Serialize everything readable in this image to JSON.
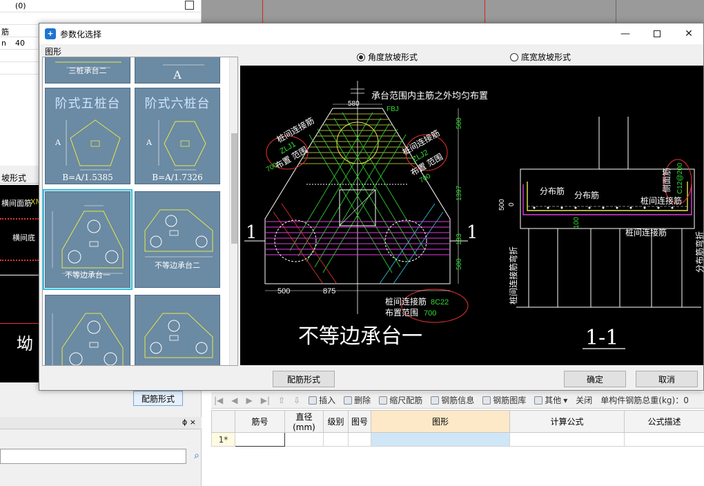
{
  "background": {
    "left_top_rows": [
      "(0)",
      "",
      "筋",
      "n",
      "40"
    ],
    "left_mid_label": "坡形式",
    "cad_left_texts": [
      "横间面筋",
      "XM",
      "横间底",
      "坳"
    ],
    "behind_button": "配筋形式",
    "panel_pin": "ɸ ×"
  },
  "toolbar": {
    "items": [
      "插入",
      "删除",
      "缩尺配筋",
      "钢筋信息",
      "钢筋图库",
      "其他",
      "关闭"
    ],
    "total_label": "单构件钢筋总重(kg)：0"
  },
  "grid": {
    "headers": [
      "",
      "筋号",
      "直径(mm)",
      "级别",
      "图号",
      "图形",
      "计算公式",
      "公式描述"
    ],
    "rows": [
      [
        "1*",
        "",
        "",
        "",
        "",
        "",
        "",
        ""
      ]
    ]
  },
  "dialog": {
    "title": "参数化选择",
    "shape_label": "图形",
    "radio_angle": "角度放坡形式",
    "radio_width": "底宽放坡形式",
    "btn_config": "配筋形式",
    "btn_ok": "确定",
    "btn_cancel": "取消"
  },
  "thumbnails": [
    {
      "label": "三桩承台二",
      "sublabel": ""
    },
    {
      "label": "A",
      "sublabel": ""
    },
    {
      "label": "阶式五桩台",
      "sublabel": "B=A/1.5385",
      "axis": "A"
    },
    {
      "label": "阶式六桩台",
      "sublabel": "B=A/1.7326",
      "axis": "A"
    },
    {
      "label": "不等边承台一",
      "sublabel": ""
    },
    {
      "label": "不等边承台二",
      "sublabel": ""
    }
  ],
  "drawing": {
    "top_note": "承台范围内主筋之外均匀布置",
    "fbj": "FBJ",
    "dim_580": "580",
    "left_note1": "桩间连接筋",
    "left_note2": "ZLJ1",
    "left_note3": "布置 范围",
    "left_note4": "700",
    "right_note1": "桩间连接筋",
    "right_note2": "ZLJ2",
    "right_note3": "布置 范围",
    "right_note4": "700",
    "dim_500a": "500",
    "dim_1397": "1397",
    "dim_133": "133",
    "dim_500b": "500",
    "dim_h500": "500",
    "dim_h875": "875",
    "sec_mark": "1",
    "bottom_note1": "桩间连接筋",
    "bottom_note1b": "8C22",
    "bottom_note2": "布置范围",
    "bottom_note2b": "700",
    "main_title": "不等边承台一",
    "sec_dist1": "分布筋",
    "sec_dist2": "分布筋",
    "sec_side": "侧面筋",
    "sec_side_val": "C12@200",
    "sec_link": "桩间连接筋",
    "sec_link2": "桩间连接筋",
    "sec_bend": "桩间连接筋弯折",
    "sec_bend2": "分布筋弯折",
    "sec_500": "500",
    "sec_0": "0",
    "sec_100": "100",
    "sec_title": "1-1"
  }
}
